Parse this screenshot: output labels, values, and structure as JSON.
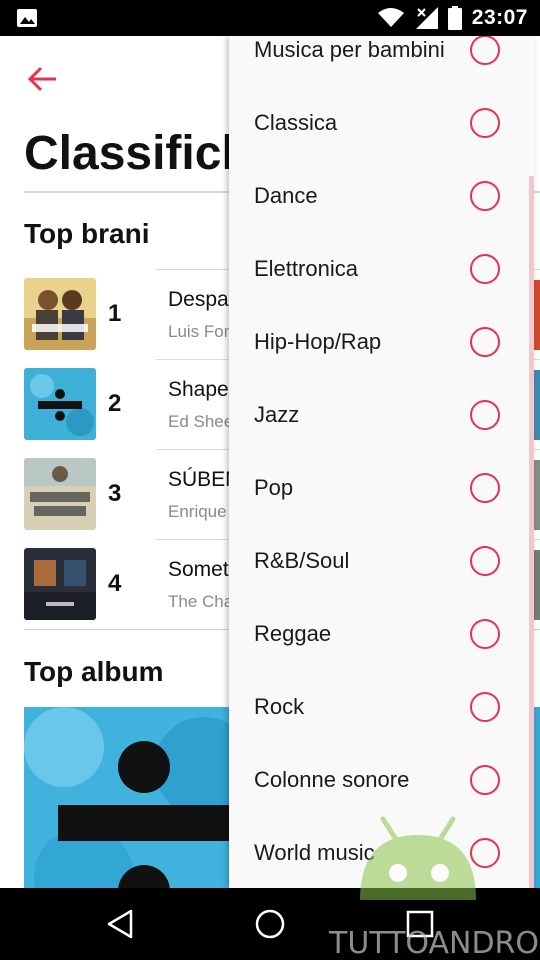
{
  "status_bar": {
    "time": "23:07",
    "icons": [
      "image-notification-icon",
      "wifi-icon",
      "cell-signal-icon",
      "battery-icon"
    ]
  },
  "page": {
    "title": "Classifiche",
    "songs_section": "Top brani",
    "albums_section": "Top album",
    "songs": [
      {
        "rank": "1",
        "title": "Despacito",
        "artist": "Luis Fonsi"
      },
      {
        "rank": "2",
        "title": "Shape of You",
        "artist": "Ed Sheeran"
      },
      {
        "rank": "3",
        "title": "SÚBEME LA RADIO",
        "artist": "Enrique Iglesias"
      },
      {
        "rank": "4",
        "title": "Something Just Like This",
        "artist": "The Chainsmokers"
      }
    ]
  },
  "dropdown": {
    "genres": [
      "Musica per bambini",
      "Classica",
      "Dance",
      "Elettronica",
      "Hip-Hop/Rap",
      "Jazz",
      "Pop",
      "R&B/Soul",
      "Reggae",
      "Rock",
      "Colonne sonore",
      "World music"
    ]
  },
  "watermark": {
    "text": "TUTTOANDROID"
  },
  "colors": {
    "accent": "#e8314f",
    "background": "#ffffff",
    "menu_background": "#f9f9f9"
  }
}
